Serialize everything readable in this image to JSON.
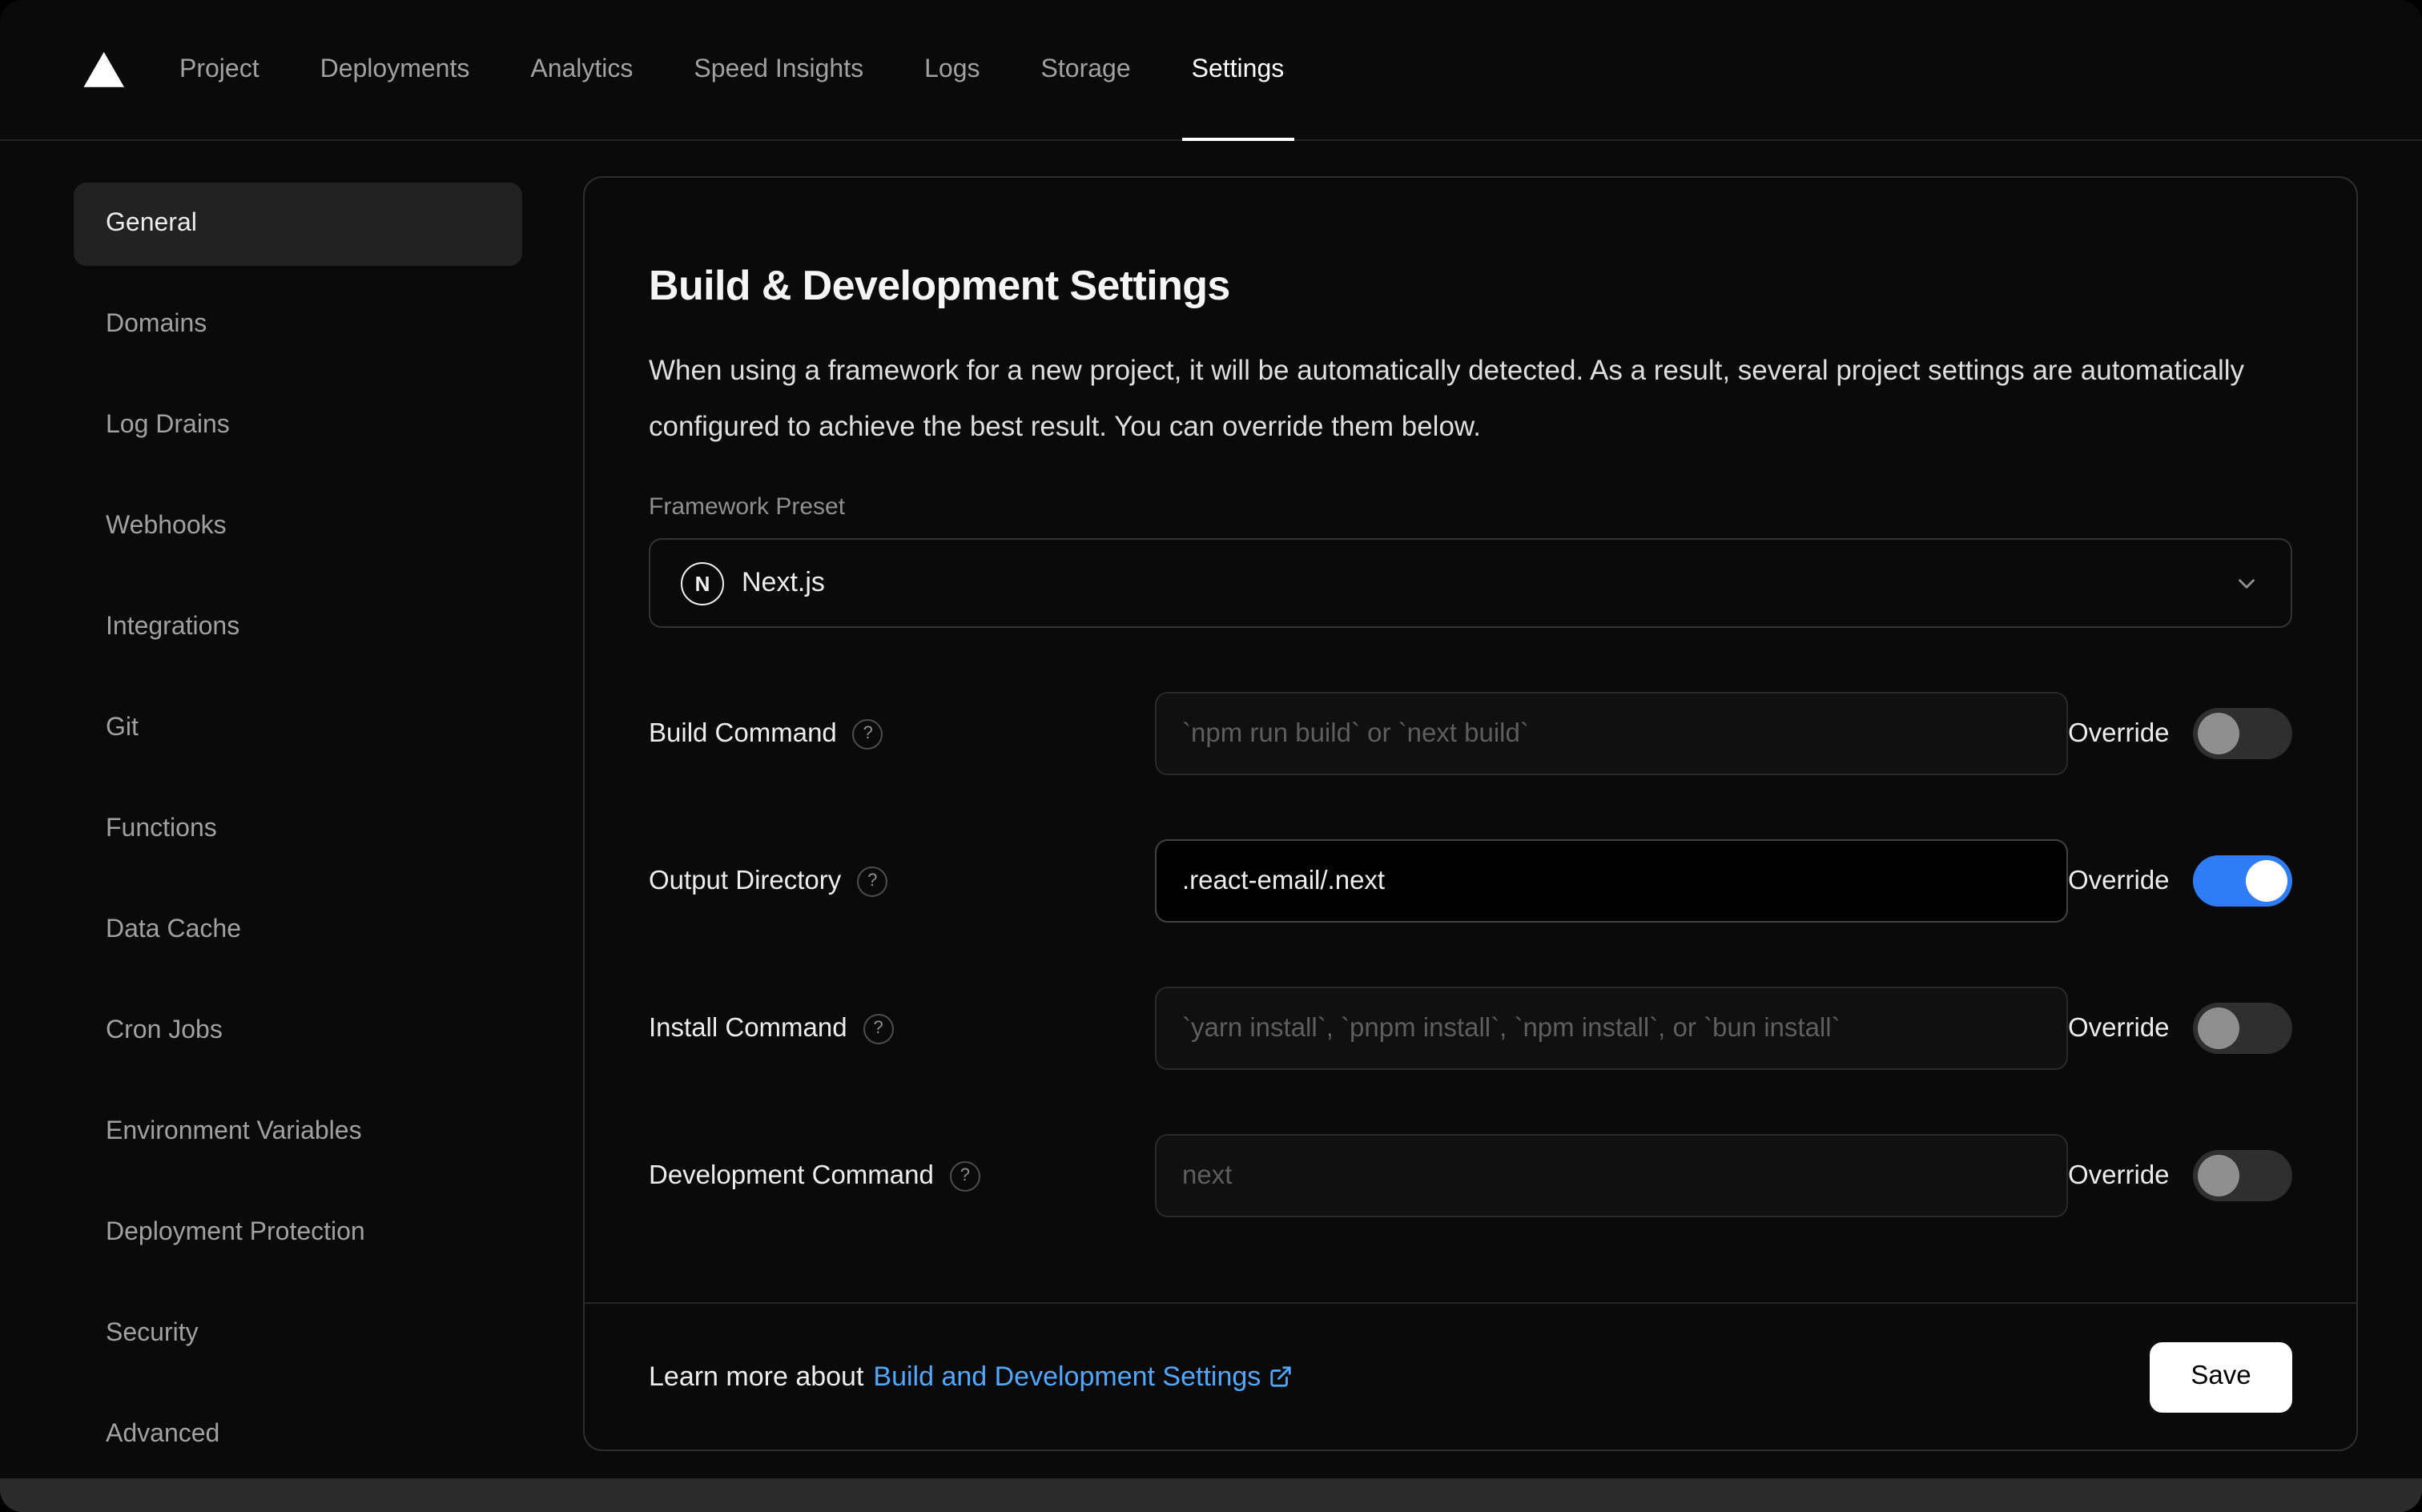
{
  "nav": {
    "items": [
      {
        "label": "Project"
      },
      {
        "label": "Deployments"
      },
      {
        "label": "Analytics"
      },
      {
        "label": "Speed Insights"
      },
      {
        "label": "Logs"
      },
      {
        "label": "Storage"
      },
      {
        "label": "Settings",
        "active": true
      }
    ]
  },
  "sidebar": {
    "active": "General",
    "items": [
      {
        "label": "General"
      },
      {
        "label": "Domains"
      },
      {
        "label": "Log Drains"
      },
      {
        "label": "Webhooks"
      },
      {
        "label": "Integrations"
      },
      {
        "label": "Git"
      },
      {
        "label": "Functions"
      },
      {
        "label": "Data Cache"
      },
      {
        "label": "Cron Jobs"
      },
      {
        "label": "Environment Variables"
      },
      {
        "label": "Deployment Protection"
      },
      {
        "label": "Security"
      },
      {
        "label": "Advanced"
      }
    ]
  },
  "card": {
    "title": "Build & Development Settings",
    "description": "When using a framework for a new project, it will be automatically detected. As a result, several project settings are automatically configured to achieve the best result. You can override them below.",
    "framework_preset": {
      "label": "Framework Preset",
      "value": "Next.js"
    },
    "override_label": "Override",
    "rows": [
      {
        "label": "Build Command",
        "placeholder": "`npm run build` or `next build`",
        "value": "",
        "override": false
      },
      {
        "label": "Output Directory",
        "placeholder": "",
        "value": ".react-email/.next",
        "override": true
      },
      {
        "label": "Install Command",
        "placeholder": "`yarn install`, `pnpm install`, `npm install`, or `bun install`",
        "value": "",
        "override": false
      },
      {
        "label": "Development Command",
        "placeholder": "next",
        "value": "",
        "override": false
      }
    ],
    "footer": {
      "learn_more_prefix": "Learn more about",
      "link_label": "Build and Development Settings",
      "save_label": "Save"
    }
  },
  "icons": {
    "vercel_logo": "white upward triangle",
    "nextjs_logo": "circle with N",
    "chevron_down": "dropdown chevron",
    "help": "question mark circle",
    "external_link": "box with arrow"
  },
  "colors": {
    "background": "#0a0a0a",
    "card_border": "#2e2e2e",
    "toggle_on": "#2f7df6",
    "link_blue": "#52a8ff",
    "active_sidebar_bg": "#222222",
    "save_button_bg": "#ffffff"
  }
}
